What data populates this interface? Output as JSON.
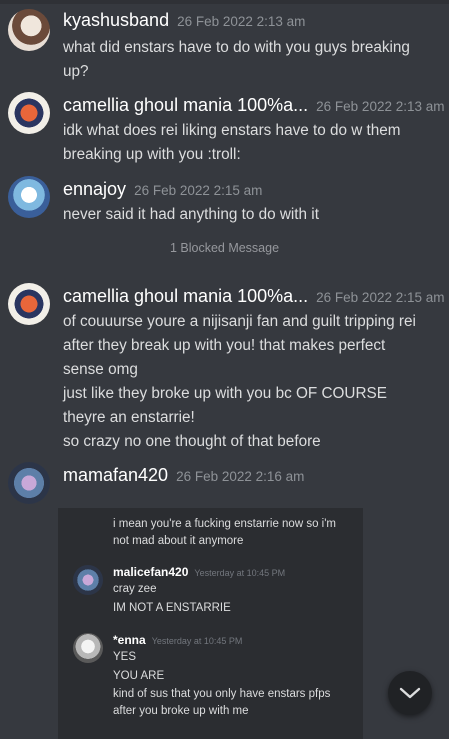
{
  "messages": [
    {
      "username": "kyashusband",
      "timestamp": "26 Feb 2022 2:13 am",
      "lines": [
        "what did enstars have to do with you guys breaking",
        "up?"
      ]
    },
    {
      "username": "camellia ghoul mania 100%a...",
      "timestamp": "26 Feb 2022 2:13 am",
      "lines": [
        "idk what does rei liking enstars have to do w them",
        "breaking up with you :troll:"
      ]
    },
    {
      "username": "ennajoy",
      "timestamp": "26 Feb 2022 2:15 am",
      "lines": [
        "never said it had anything to do with it"
      ]
    },
    {
      "username": "camellia ghoul mania 100%a...",
      "timestamp": "26 Feb 2022 2:15 am",
      "lines": [
        "of couuurse youre a nijisanji fan and guilt tripping rei",
        "after they break up with you! that makes perfect",
        "sense omg",
        "just like they broke up with you bc OF COURSE",
        "theyre an enstarrie!",
        "so crazy no one thought of that before"
      ]
    },
    {
      "username": "mamafan420",
      "timestamp": "26 Feb 2022 2:16 am",
      "lines": []
    }
  ],
  "blocked_message": "1 Blocked Message",
  "embed": {
    "intro_lines": [
      "i mean you're a fucking enstarrie now so i'm",
      "not mad about it anymore"
    ],
    "replies": [
      {
        "username": "malicefan420",
        "timestamp": "Yesterday at 10:45 PM",
        "lines": [
          "cray zee",
          "IM NOT A ENSTARRIE"
        ]
      },
      {
        "username": "*enna",
        "timestamp": "Yesterday at 10:45 PM",
        "lines": [
          "YES",
          "YOU ARE",
          "kind of sus that you only have enstars pfps",
          "after you broke up with me"
        ]
      }
    ]
  },
  "icons": {
    "scroll_down": "chevron-down-icon"
  },
  "colors": {
    "background": "#36393f",
    "username": "#ffffff",
    "timestamp": "#8e9297",
    "text": "#dcddde",
    "embed_bg": "#2b2d31"
  }
}
